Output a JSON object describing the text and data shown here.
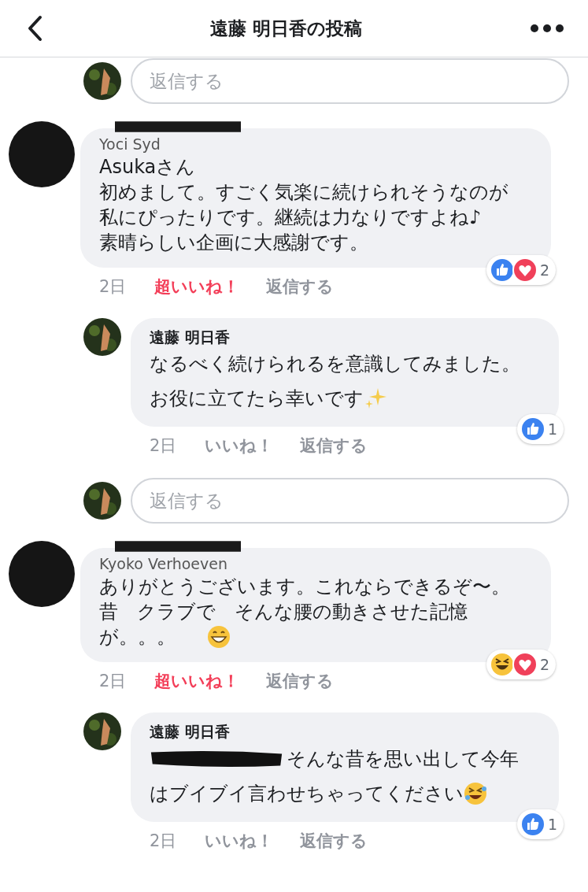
{
  "header": {
    "title": "遠藤 明日香の投稿"
  },
  "items": [
    {
      "kind": "reply_box",
      "placeholder": "返信する"
    },
    {
      "kind": "comment",
      "author": "Yoci Syd",
      "author_redacted": true,
      "lines": [
        {
          "kind": "plain",
          "text": "Asukaさん"
        },
        {
          "kind": "plain",
          "text": "初めまして。すごく気楽に続けられそうなのが"
        },
        {
          "kind": "plain",
          "text": "私にぴったりです。継続は力なりですよね♪"
        },
        {
          "kind": "plain",
          "text": "素晴らしい企画に大感謝です。"
        }
      ],
      "time": "2日",
      "reaction_label": "超いいね！",
      "reacted": true,
      "reply_label": "返信する",
      "reactions": [
        {
          "kind": "like"
        },
        {
          "kind": "love"
        }
      ],
      "reaction_count": "2",
      "children": [
        {
          "kind": "comment",
          "author": "遠藤 明日香",
          "lines": [
            {
              "kind": "plain",
              "text": "なるべく続けられるを意識してみました。"
            },
            {
              "kind": "sparkles",
              "text": "お役に立てたら幸いです"
            }
          ],
          "time": "2日",
          "reaction_label": "いいね！",
          "reacted": false,
          "reply_label": "返信する",
          "reactions": [
            {
              "kind": "like"
            }
          ],
          "reaction_count": "1"
        }
      ]
    },
    {
      "kind": "reply_box",
      "placeholder": "返信する"
    },
    {
      "kind": "comment",
      "author": "Kyoko Verhoeven",
      "author_redacted": true,
      "lines": [
        {
          "kind": "plain",
          "text": "ありがとうございます。これならできるぞ〜。"
        },
        {
          "kind": "plain",
          "text": "昔　クラブで　そんな腰の動きさせた記憶"
        },
        {
          "kind": "grin",
          "text": "が。。。"
        }
      ],
      "time": "2日",
      "reaction_label": "超いいね！",
      "reacted": true,
      "reply_label": "返信する",
      "reactions": [
        {
          "kind": "haha"
        },
        {
          "kind": "love"
        }
      ],
      "reaction_count": "2",
      "children": [
        {
          "kind": "comment",
          "author": "遠藤 明日香",
          "lines": [
            {
              "kind": "redacted_start",
              "text": "そんな昔を思い出して今年"
            },
            {
              "kind": "rofl",
              "text": "はブイブイ言わせちゃってください"
            }
          ],
          "time": "2日",
          "reaction_label": "いいね！",
          "reacted": false,
          "reply_label": "返信する",
          "reactions": [
            {
              "kind": "like"
            }
          ],
          "reaction_count": "1"
        }
      ]
    }
  ]
}
